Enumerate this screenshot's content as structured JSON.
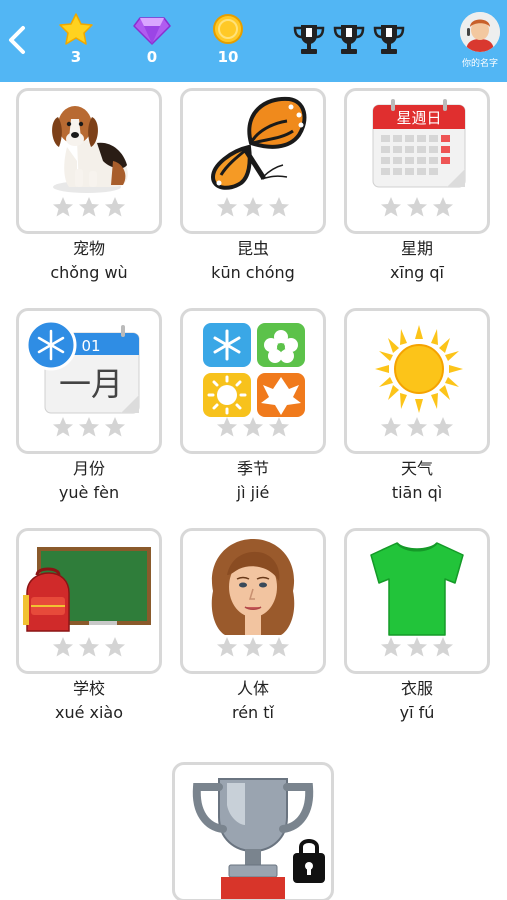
{
  "header": {
    "stars_count": "3",
    "gems_count": "0",
    "coins_count": "10",
    "user_name": "你的名字"
  },
  "colors": {
    "header_bg": "#52b6f4",
    "card_border": "#d8d8d8",
    "star_empty": "#d4d4d4"
  },
  "categories": [
    {
      "cn": "宠物",
      "py": "chǒng wù",
      "icon": "dog-image",
      "stars": 0
    },
    {
      "cn": "昆虫",
      "py": "kūn chóng",
      "icon": "butterfly-image",
      "stars": 0
    },
    {
      "cn": "星期",
      "py": "xīng qī",
      "icon": "calendar-week-image",
      "calendar_title": "星週日",
      "stars": 0
    },
    {
      "cn": "月份",
      "py": "yuè fèn",
      "icon": "calendar-month-image",
      "calendar_number": "01",
      "calendar_text": "一月",
      "stars": 0
    },
    {
      "cn": "季节",
      "py": "jì jié",
      "icon": "seasons-image",
      "stars": 0
    },
    {
      "cn": "天气",
      "py": "tiān qì",
      "icon": "sun-image",
      "stars": 0
    },
    {
      "cn": "学校",
      "py": "xué xiào",
      "icon": "school-image",
      "stars": 0
    },
    {
      "cn": "人体",
      "py": "rén tǐ",
      "icon": "woman-face-image",
      "stars": 0
    },
    {
      "cn": "衣服",
      "py": "yī fú",
      "icon": "tshirt-image",
      "stars": 0
    }
  ],
  "locked_trophy": {
    "icon": "locked-trophy-image",
    "locked": true
  }
}
